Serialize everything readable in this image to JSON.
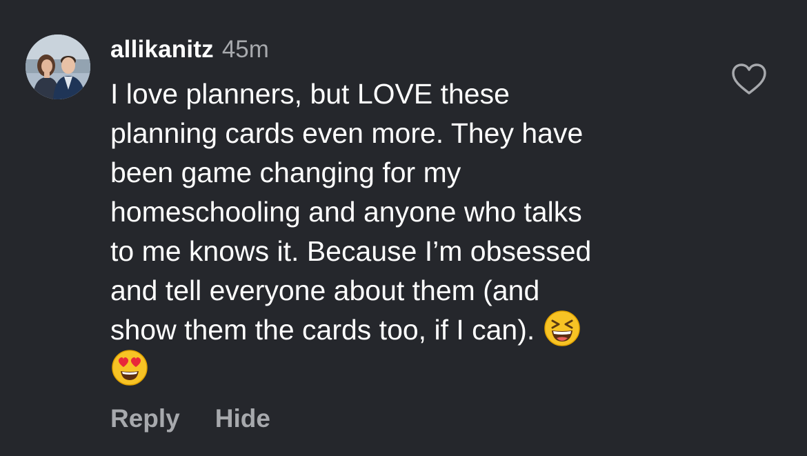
{
  "comment": {
    "username": "allikanitz",
    "timestamp": "45m",
    "avatar": "avatar-photo",
    "body_lines": [
      "I love planners, but LOVE these",
      "planning cards even more. They have",
      "been game changing for my",
      "homeschooling and anyone who talks",
      "to me knows it. Because I’m obsessed",
      "and tell everyone about them (and",
      "show them the cards too, if I can)."
    ],
    "emojis": [
      "grinning-squinting-face-emoji",
      "heart-eyes-emoji"
    ],
    "like_icon": "heart-icon",
    "actions": {
      "reply_label": "Reply",
      "hide_label": "Hide"
    }
  },
  "colors": {
    "background": "#25272c",
    "text_primary": "#ffffff",
    "text_secondary": "#a7a9ad"
  }
}
